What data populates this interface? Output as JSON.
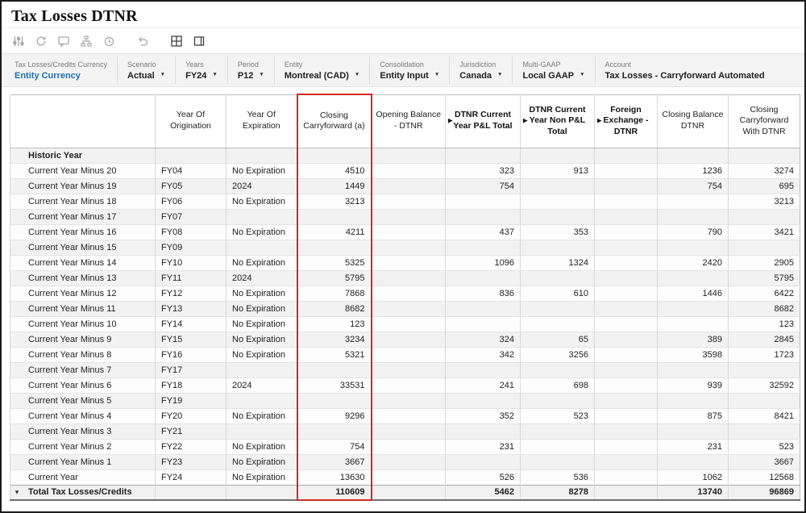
{
  "window": {
    "title": "Tax Losses DTNR"
  },
  "colors": {
    "highlight_border": "#cf2b27",
    "link": "#1f6db6"
  },
  "toolbar": {
    "icons": [
      {
        "name": "pov-options-icon",
        "enabled": false
      },
      {
        "name": "refresh-icon",
        "enabled": false
      },
      {
        "name": "comment-icon",
        "enabled": false
      },
      {
        "name": "hierarchy-icon",
        "enabled": false
      },
      {
        "name": "history-icon",
        "enabled": false
      },
      {
        "name": "undo-icon",
        "enabled": false,
        "gap": true
      },
      {
        "name": "grid-icon",
        "enabled": true,
        "gap": true
      },
      {
        "name": "open-window-icon",
        "enabled": true
      }
    ]
  },
  "pov": {
    "fields": [
      {
        "label": "Tax Losses/Credits Currency",
        "value": "Entity Currency",
        "style": "link",
        "dropdown": false
      },
      {
        "label": "Scenario",
        "value": "Actual",
        "dropdown": true
      },
      {
        "label": "Years",
        "value": "FY24",
        "dropdown": true
      },
      {
        "label": "Period",
        "value": "P12",
        "dropdown": true
      },
      {
        "label": "Entity",
        "value": "Montreal (CAD)",
        "dropdown": true
      },
      {
        "label": "Consolidation",
        "value": "Entity Input",
        "dropdown": true
      },
      {
        "label": "Jurisdiction",
        "value": "Canada",
        "dropdown": true
      },
      {
        "label": "Multi-GAAP",
        "value": "Local GAAP",
        "dropdown": true
      },
      {
        "label": "Account",
        "value": "Tax Losses - Carryforward Automated",
        "dropdown": false
      }
    ]
  },
  "grid": {
    "columns": [
      {
        "key": "label",
        "label": ""
      },
      {
        "key": "origination",
        "label": "Year Of Origination"
      },
      {
        "key": "expiration",
        "label": "Year Of Expiration"
      },
      {
        "key": "closing_cf",
        "label": "Closing Carryforward (a)",
        "highlighted": true
      },
      {
        "key": "opening_dtnr",
        "label": "Opening Balance - DTNR"
      },
      {
        "key": "pl_total",
        "label": "DTNR Current Year P&L Total",
        "bold": true,
        "expand": true
      },
      {
        "key": "nonpl_total",
        "label": "DTNR Current Year Non P&L Total",
        "bold": true,
        "expand": true
      },
      {
        "key": "fx_dtnr",
        "label": "Foreign Exchange - DTNR",
        "bold": true,
        "expand": true
      },
      {
        "key": "closing_dtnr",
        "label": "Closing Balance DTNR"
      },
      {
        "key": "closing_cf_dtnr",
        "label": "Closing Carryforward With DTNR"
      }
    ],
    "rows": [
      {
        "label": "Historic Year",
        "bold": true,
        "cells": [
          "",
          "",
          "",
          "",
          "",
          "",
          "",
          "",
          ""
        ]
      },
      {
        "label": "Current Year Minus 20",
        "cells": [
          "FY04",
          "No Expiration",
          "4510",
          "",
          "323",
          "913",
          "",
          "1236",
          "3274"
        ]
      },
      {
        "label": "Current Year Minus 19",
        "cells": [
          "FY05",
          "2024",
          "1449",
          "",
          "754",
          "",
          "",
          "754",
          "695"
        ]
      },
      {
        "label": "Current Year Minus 18",
        "cells": [
          "FY06",
          "No Expiration",
          "3213",
          "",
          "",
          "",
          "",
          "",
          "3213"
        ]
      },
      {
        "label": "Current Year Minus 17",
        "cells": [
          "FY07",
          "",
          "",
          "",
          "",
          "",
          "",
          "",
          ""
        ]
      },
      {
        "label": "Current Year Minus 16",
        "cells": [
          "FY08",
          "No Expiration",
          "4211",
          "",
          "437",
          "353",
          "",
          "790",
          "3421"
        ]
      },
      {
        "label": "Current Year Minus 15",
        "cells": [
          "FY09",
          "",
          "",
          "",
          "",
          "",
          "",
          "",
          ""
        ]
      },
      {
        "label": "Current Year Minus 14",
        "cells": [
          "FY10",
          "No Expiration",
          "5325",
          "",
          "1096",
          "1324",
          "",
          "2420",
          "2905"
        ]
      },
      {
        "label": "Current Year Minus 13",
        "cells": [
          "FY11",
          "2024",
          "5795",
          "",
          "",
          "",
          "",
          "",
          "5795"
        ]
      },
      {
        "label": "Current Year Minus 12",
        "cells": [
          "FY12",
          "No Expiration",
          "7868",
          "",
          "836",
          "610",
          "",
          "1446",
          "6422"
        ]
      },
      {
        "label": "Current Year Minus 11",
        "cells": [
          "FY13",
          "No Expiration",
          "8682",
          "",
          "",
          "",
          "",
          "",
          "8682"
        ]
      },
      {
        "label": "Current Year Minus 10",
        "cells": [
          "FY14",
          "No Expiration",
          "123",
          "",
          "",
          "",
          "",
          "",
          "123"
        ]
      },
      {
        "label": "Current Year Minus 9",
        "cells": [
          "FY15",
          "No Expiration",
          "3234",
          "",
          "324",
          "65",
          "",
          "389",
          "2845"
        ]
      },
      {
        "label": "Current Year Minus 8",
        "cells": [
          "FY16",
          "No Expiration",
          "5321",
          "",
          "342",
          "3256",
          "",
          "3598",
          "1723"
        ]
      },
      {
        "label": "Current Year Minus 7",
        "cells": [
          "FY17",
          "",
          "",
          "",
          "",
          "",
          "",
          "",
          ""
        ]
      },
      {
        "label": "Current Year Minus 6",
        "cells": [
          "FY18",
          "2024",
          "33531",
          "",
          "241",
          "698",
          "",
          "939",
          "32592"
        ]
      },
      {
        "label": "Current Year Minus 5",
        "cells": [
          "FY19",
          "",
          "",
          "",
          "",
          "",
          "",
          "",
          ""
        ]
      },
      {
        "label": "Current Year Minus 4",
        "cells": [
          "FY20",
          "No Expiration",
          "9296",
          "",
          "352",
          "523",
          "",
          "875",
          "8421"
        ]
      },
      {
        "label": "Current Year Minus 3",
        "cells": [
          "FY21",
          "",
          "",
          "",
          "",
          "",
          "",
          "",
          ""
        ]
      },
      {
        "label": "Current Year Minus 2",
        "cells": [
          "FY22",
          "No Expiration",
          "754",
          "",
          "231",
          "",
          "",
          "231",
          "523"
        ]
      },
      {
        "label": "Current Year Minus 1",
        "cells": [
          "FY23",
          "No Expiration",
          "3667",
          "",
          "",
          "",
          "",
          "",
          "3667"
        ]
      },
      {
        "label": "Current Year",
        "cells": [
          "FY24",
          "No Expiration",
          "13630",
          "",
          "526",
          "536",
          "",
          "1062",
          "12568"
        ]
      }
    ],
    "total_row": {
      "label": "Total Tax Losses/Credits",
      "cells": [
        "",
        "",
        "110609",
        "",
        "5462",
        "8278",
        "",
        "13740",
        "96869"
      ]
    }
  }
}
